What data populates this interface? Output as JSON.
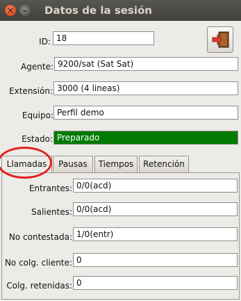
{
  "window": {
    "title": "Datos de la sesión"
  },
  "fields": {
    "id": {
      "label": "ID:",
      "value": "18"
    },
    "agente": {
      "label": "Agente:",
      "value": "9200/sat (Sat Sat)"
    },
    "extension": {
      "label": "Extensión:",
      "value": "3000 (4 lineas)"
    },
    "equipo": {
      "label": "Equipo:",
      "value": "Perfil demo"
    },
    "estado": {
      "label": "Estado:",
      "value": "Preparado",
      "status_color": "#007a00"
    }
  },
  "tabs": [
    {
      "label": "Llamadas",
      "active": true
    },
    {
      "label": "Pausas"
    },
    {
      "label": "Tiempos"
    },
    {
      "label": "Retención"
    }
  ],
  "llamadas": {
    "entrantes": {
      "label": "Entrantes:",
      "value": "0/0(acd)"
    },
    "salientes": {
      "label": "Salientes:",
      "value": "0/0(acd)"
    },
    "no_contestada": {
      "label": "No contestada:",
      "value": "1/0(entr)"
    },
    "no_colg_cliente": {
      "label": "No colg. cliente:",
      "value": "0"
    },
    "colg_retenidas": {
      "label": "Colg. retenidas:",
      "value": "0"
    }
  },
  "icons": {
    "exit_button": "exit-door-icon"
  },
  "annotation": {
    "highlight_color": "#e51e1e"
  }
}
